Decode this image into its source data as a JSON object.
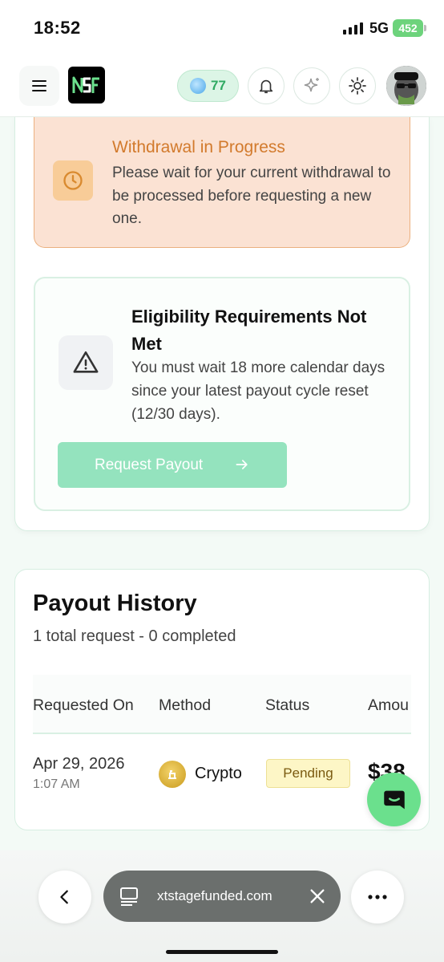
{
  "status_bar": {
    "time": "18:52",
    "network": "5G",
    "battery": "452"
  },
  "header": {
    "logo": "NSF",
    "points": "77"
  },
  "withdrawal_alert": {
    "title": "Withdrawal in Progress",
    "text": "Please wait for your current withdrawal to be processed before requesting a new one."
  },
  "eligibility": {
    "title": "Eligibility Requirements Not Met",
    "text": "You must wait 18 more calendar days since your latest payout cycle reset (12/30 days).",
    "button_label": "Request Payout"
  },
  "payout_history": {
    "title": "Payout History",
    "subtitle": "1 total request - 0 completed",
    "columns": [
      "Requested On",
      "Method",
      "Status",
      "Amou"
    ],
    "rows": [
      {
        "date": "Apr 29, 2026",
        "time": "1:07 AM",
        "method": "Crypto",
        "status": "Pending",
        "amount": "$38"
      }
    ]
  },
  "browser": {
    "url": "xtstagefunded.com"
  },
  "colors": {
    "accent": "#6be08d",
    "warning": "#d27a2c",
    "button_disabled": "#94e3be"
  }
}
